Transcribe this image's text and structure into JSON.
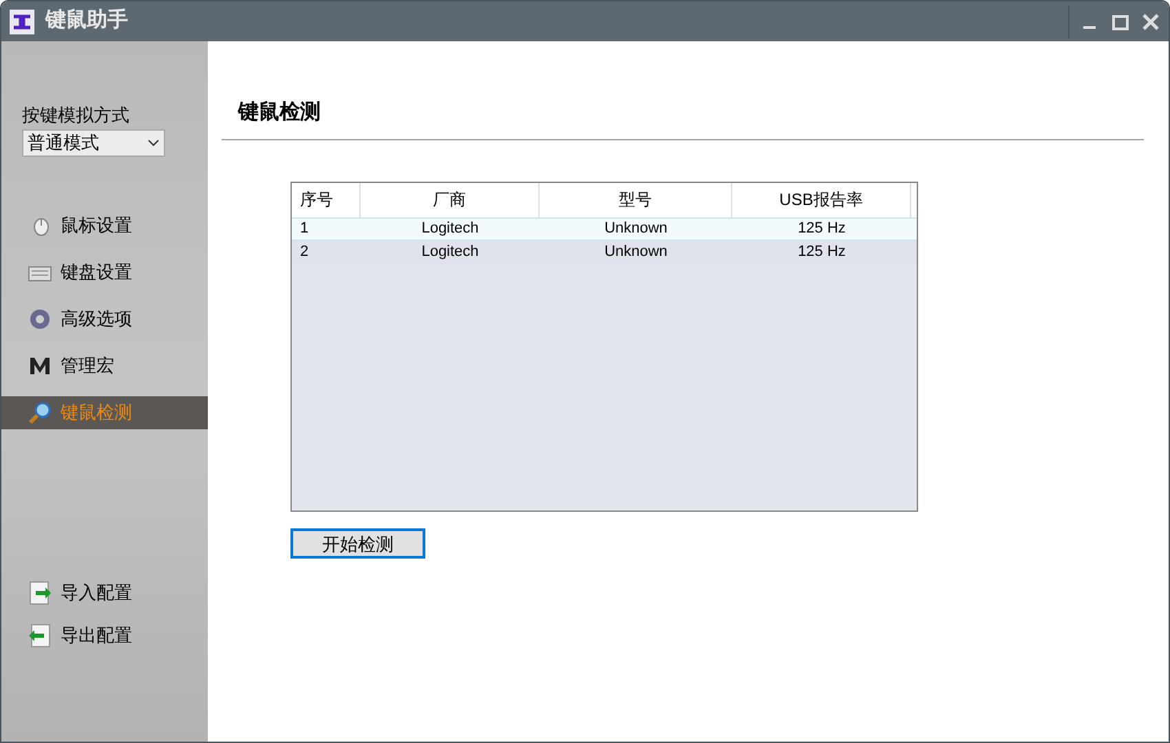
{
  "window": {
    "title": "键鼠助手"
  },
  "sidebar": {
    "mode_label": "按键模拟方式",
    "mode_value": "普通模式",
    "items": [
      {
        "label": "鼠标设置",
        "kind": "mouse",
        "selected": false
      },
      {
        "label": "键盘设置",
        "kind": "keyboard",
        "selected": false
      },
      {
        "label": "高级选项",
        "kind": "gear",
        "selected": false
      },
      {
        "label": "管理宏",
        "kind": "macro",
        "selected": false
      },
      {
        "label": "键鼠检测",
        "kind": "magnifier",
        "selected": true
      }
    ],
    "config_items": [
      {
        "label": "导入配置",
        "kind": "import"
      },
      {
        "label": "导出配置",
        "kind": "export"
      }
    ]
  },
  "main": {
    "heading": "键鼠检测",
    "table": {
      "columns": [
        "序号",
        "厂商",
        "型号",
        "USB报告率"
      ],
      "rows": [
        {
          "cells": [
            "1",
            "Logitech",
            "Unknown",
            "125 Hz"
          ],
          "selected": true
        },
        {
          "cells": [
            "2",
            "Logitech",
            "Unknown",
            "125 Hz"
          ],
          "selected": false
        }
      ]
    },
    "start_button": "开始检测"
  }
}
